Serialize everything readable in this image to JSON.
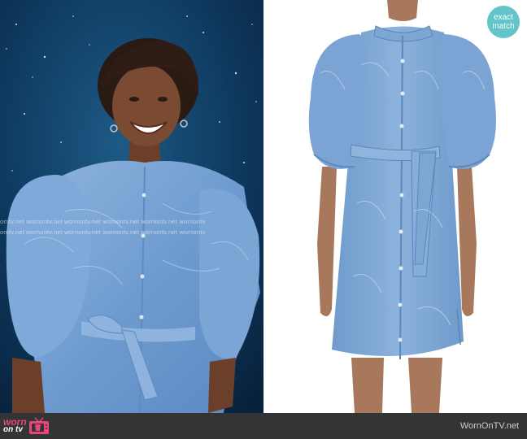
{
  "badge": {
    "line1": "exact",
    "line2": "match"
  },
  "watermark": {
    "line1": "omtv.net  wornontv.net  wornontv.net  wornontv.net  wornontv.net  wornontv",
    "line2": "omtv.net  wornontv.net  wornontv.net  wornontv.net  wornontv.net  wornontv"
  },
  "footer": {
    "logo_line1": "worn",
    "logo_line2": "on tv",
    "site": "WornOnTV.net"
  },
  "colors": {
    "badge": "#62c5c9",
    "footer_bg": "#333436",
    "logo_pink": "#e8457e",
    "denim": "#7da6d4"
  }
}
